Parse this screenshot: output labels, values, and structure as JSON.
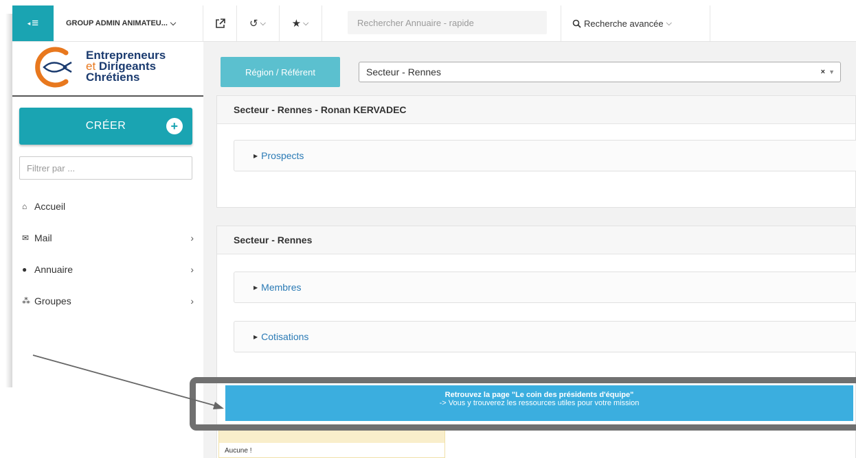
{
  "topbar": {
    "group_label": "GROUP ADMIN ANIMATEU...",
    "search_placeholder": "Rechercher Annuaire - rapide",
    "advanced_search_label": "Recherche avancée"
  },
  "sidebar": {
    "logo": {
      "line1": "Entrepreneurs",
      "line2_prefix": "et",
      "line2": "Dirigeants",
      "line3": "Chrétiens"
    },
    "create_label": "CRÉER",
    "filter_placeholder": "Filtrer par ...",
    "items": [
      {
        "label": "Accueil",
        "icon": "home-icon"
      },
      {
        "label": "Mail",
        "icon": "envelope-icon"
      },
      {
        "label": "Annuaire",
        "icon": "user-icon"
      },
      {
        "label": "Groupes",
        "icon": "users-icon"
      }
    ]
  },
  "main": {
    "region_button": "Région / Référent",
    "selected_sector": "Secteur - Rennes",
    "panel1": {
      "title": "Secteur - Rennes - Ronan KERVADEC",
      "sections": [
        "Prospects"
      ]
    },
    "panel2": {
      "title": "Secteur - Rennes",
      "sections": [
        "Membres",
        "Cotisations"
      ]
    }
  },
  "banner": {
    "line1": "Retrouvez la page \"Le coin des présidents d'équipe\"",
    "line2": "-> Vous y trouverez les ressources utiles pour votre mission"
  },
  "bottom_box": {
    "text": "Aucune !"
  },
  "colors": {
    "teal": "#1aa4b2",
    "light_teal": "#5bc0cf",
    "banner_blue": "#3baedf",
    "logo_orange": "#e8781e",
    "logo_navy": "#1b3b6f",
    "link_blue": "#2a7ab5"
  }
}
